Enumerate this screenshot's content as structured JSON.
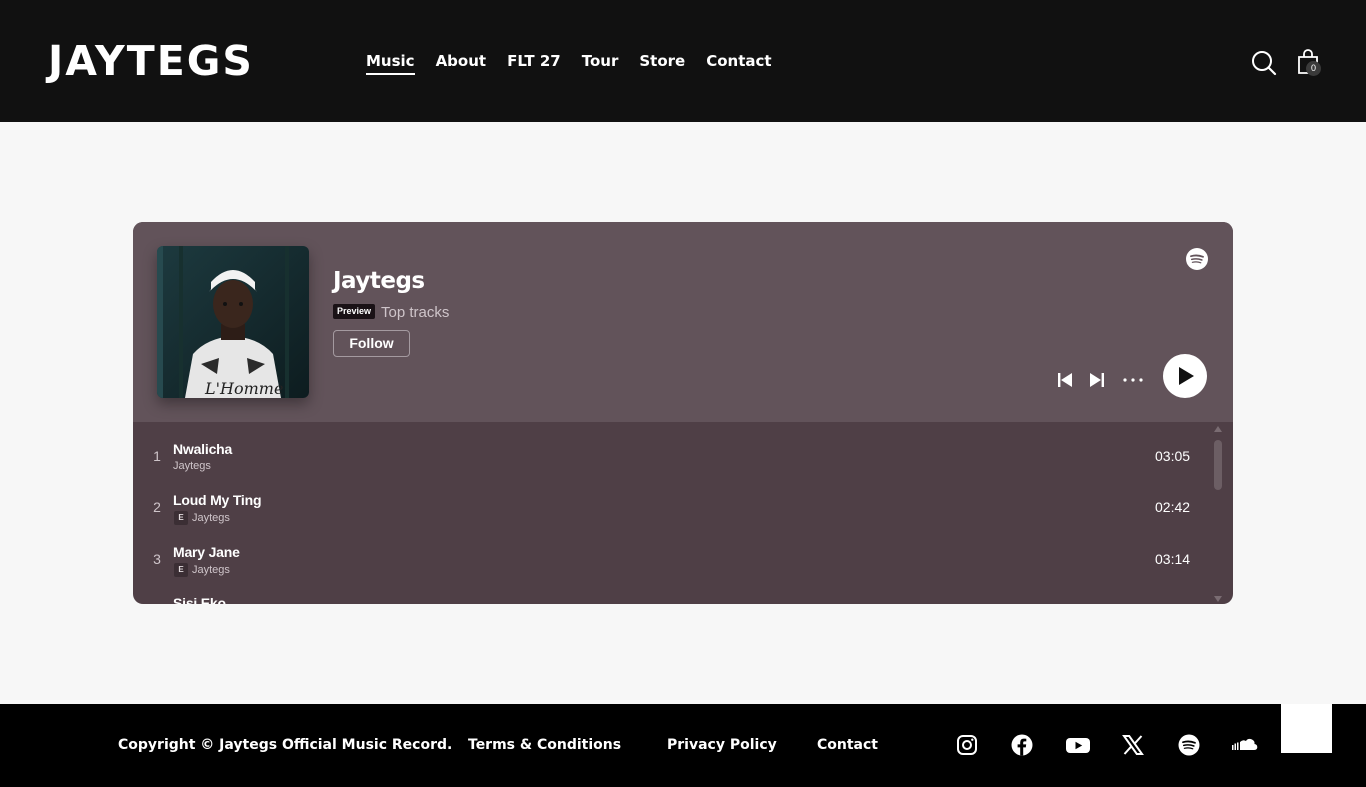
{
  "header": {
    "logo": "JAYTEGS",
    "nav": [
      "Music",
      "About",
      "FLT 27",
      "Tour",
      "Store",
      "Contact"
    ],
    "active_nav": "Music",
    "cart_count": "0"
  },
  "player": {
    "artist": "Jaytegs",
    "badge": "Preview",
    "subtitle": "Top tracks",
    "follow_label": "Follow",
    "background_color": "#62535a",
    "list_color": "#4f3f46",
    "tracks": [
      {
        "num": "1",
        "title": "Nwalicha",
        "artist": "Jaytegs",
        "explicit": false,
        "duration": "03:05"
      },
      {
        "num": "2",
        "title": "Loud My Ting",
        "artist": "Jaytegs",
        "explicit": true,
        "explicit_label": "E",
        "duration": "02:42"
      },
      {
        "num": "3",
        "title": "Mary Jane",
        "artist": "Jaytegs",
        "explicit": true,
        "explicit_label": "E",
        "duration": "03:14"
      },
      {
        "num": "",
        "title": "Sisi Eko",
        "artist": "",
        "explicit": false,
        "duration": ""
      }
    ]
  },
  "footer": {
    "copyright": "Copyright © Jaytegs Official Music Record.",
    "terms": "Terms & Conditions",
    "privacy": "Privacy Policy",
    "contact": "Contact",
    "socials": [
      "instagram-icon",
      "facebook-icon",
      "youtube-icon",
      "x-icon",
      "spotify-icon",
      "soundcloud-icon"
    ]
  }
}
